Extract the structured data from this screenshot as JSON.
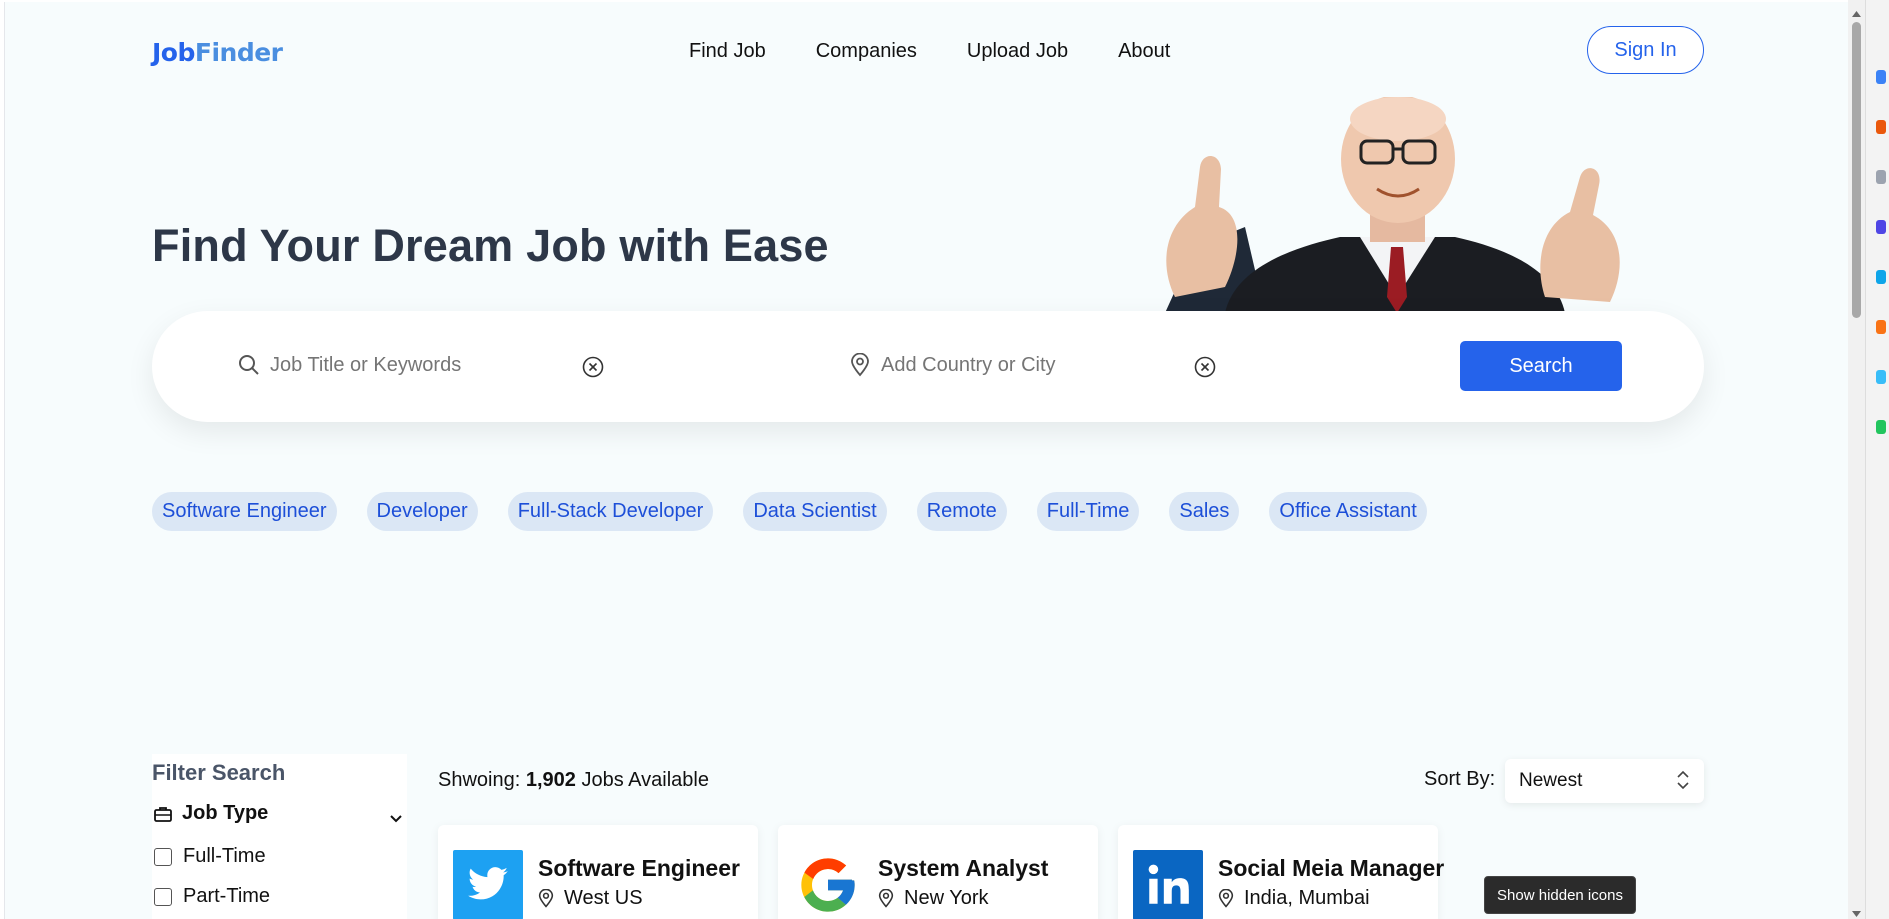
{
  "header": {
    "logo_part1": "Job",
    "logo_part2": "Finder",
    "nav": [
      "Find Job",
      "Companies",
      "Upload Job",
      "About"
    ],
    "signin_label": "Sign In"
  },
  "hero": {
    "title": "Find Your Dream Job with Ease"
  },
  "search": {
    "keyword_placeholder": "Job Title or Keywords",
    "location_placeholder": "Add Country or City",
    "button_label": "Search"
  },
  "tags": [
    "Software Engineer",
    "Developer",
    "Full-Stack Developer",
    "Data Scientist",
    "Remote",
    "Full-Time",
    "Sales",
    "Office Assistant"
  ],
  "filter": {
    "title": "Filter Search",
    "group_label": "Job Type",
    "options": [
      "Full-Time",
      "Part-Time"
    ]
  },
  "results": {
    "showing_prefix": "Shwoing:",
    "count": "1,902",
    "showing_suffix": "Jobs Available",
    "sort_label": "Sort By:",
    "sort_value": "Newest"
  },
  "jobs": [
    {
      "title": "Software Engineer",
      "location": "West US",
      "logo": "twitter-logo"
    },
    {
      "title": "System Analyst",
      "location": "New York",
      "logo": "google-logo"
    },
    {
      "title": "Social Meia Manager",
      "location": "India, Mumbai",
      "logo": "linkedin-logo"
    }
  ],
  "tooltip": "Show hidden icons",
  "colors": {
    "accent": "#2563eb",
    "tag_bg": "#dbe7f5",
    "page_bg": "#f7fcfd"
  }
}
